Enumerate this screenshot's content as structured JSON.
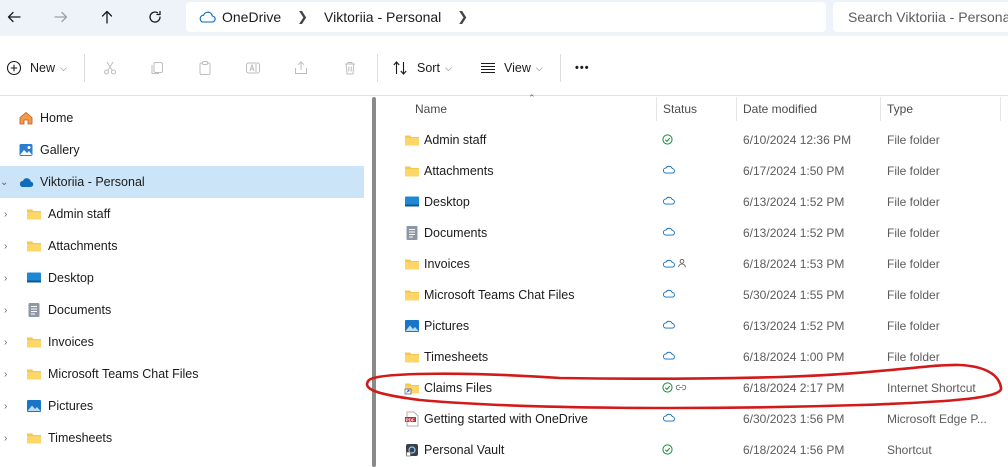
{
  "nav": {
    "back": "back-arrow-icon",
    "forward": "forward-arrow-icon",
    "up": "up-arrow-icon",
    "refresh": "refresh-icon"
  },
  "address": {
    "root": "OneDrive",
    "current": "Viktoriia - Personal"
  },
  "search": {
    "placeholder": "Search Viktoriia - Personal"
  },
  "toolbar": {
    "new_label": "New",
    "sort_label": "Sort",
    "view_label": "View",
    "more_label": "•••"
  },
  "sidebar": {
    "items": [
      {
        "label": "Home",
        "icon": "home-icon"
      },
      {
        "label": "Gallery",
        "icon": "gallery-icon"
      },
      {
        "label": "Viktoriia - Personal",
        "icon": "onedrive-cloud-icon",
        "selected": true
      },
      {
        "label": "Admin staff",
        "icon": "folder-icon"
      },
      {
        "label": "Attachments",
        "icon": "folder-icon"
      },
      {
        "label": "Desktop",
        "icon": "desktop-icon"
      },
      {
        "label": "Documents",
        "icon": "documents-icon"
      },
      {
        "label": "Invoices",
        "icon": "folder-icon"
      },
      {
        "label": "Microsoft Teams Chat Files",
        "icon": "folder-icon"
      },
      {
        "label": "Pictures",
        "icon": "pictures-icon"
      },
      {
        "label": "Timesheets",
        "icon": "folder-icon"
      }
    ]
  },
  "columns": {
    "name": "Name",
    "status": "Status",
    "date": "Date modified",
    "type": "Type"
  },
  "files": [
    {
      "name": "Admin staff",
      "icon": "folder-icon",
      "status": [
        "synced-check-icon"
      ],
      "date": "6/10/2024 12:36 PM",
      "type": "File folder"
    },
    {
      "name": "Attachments",
      "icon": "folder-icon",
      "status": [
        "cloud-icon"
      ],
      "date": "6/17/2024 1:50 PM",
      "type": "File folder"
    },
    {
      "name": "Desktop",
      "icon": "desktop-icon",
      "status": [
        "cloud-icon"
      ],
      "date": "6/13/2024 1:52 PM",
      "type": "File folder"
    },
    {
      "name": "Documents",
      "icon": "documents-icon",
      "status": [
        "cloud-icon"
      ],
      "date": "6/13/2024 1:52 PM",
      "type": "File folder"
    },
    {
      "name": "Invoices",
      "icon": "folder-icon",
      "status": [
        "cloud-icon",
        "shared-person-icon"
      ],
      "date": "6/18/2024 1:53 PM",
      "type": "File folder"
    },
    {
      "name": "Microsoft Teams Chat Files",
      "icon": "folder-icon",
      "status": [
        "cloud-icon"
      ],
      "date": "5/30/2024 1:55 PM",
      "type": "File folder"
    },
    {
      "name": "Pictures",
      "icon": "pictures-icon",
      "status": [
        "cloud-icon"
      ],
      "date": "6/13/2024 1:52 PM",
      "type": "File folder"
    },
    {
      "name": "Timesheets",
      "icon": "folder-icon",
      "status": [
        "cloud-icon"
      ],
      "date": "6/18/2024 1:00 PM",
      "type": "File folder"
    },
    {
      "name": "Claims Files",
      "icon": "shortcut-folder-icon",
      "status": [
        "synced-check-icon",
        "link-icon"
      ],
      "date": "6/18/2024 2:17 PM",
      "type": "Internet Shortcut"
    },
    {
      "name": "Getting started with OneDrive",
      "icon": "pdf-icon",
      "status": [
        "cloud-icon"
      ],
      "date": "6/30/2023 1:56 PM",
      "type": "Microsoft Edge P..."
    },
    {
      "name": "Personal Vault",
      "icon": "vault-icon",
      "status": [
        "synced-check-icon"
      ],
      "date": "6/18/2024 1:56 PM",
      "type": "Shortcut"
    }
  ],
  "colors": {
    "accent": "#0067c0",
    "selected_bg": "#cce4f7",
    "folder": "#f8c74a",
    "synced": "#1a8f3a",
    "annotation": "#d21a1a"
  },
  "annotation": {
    "shape": "hand-drawn-circle",
    "target": "Claims Files"
  }
}
